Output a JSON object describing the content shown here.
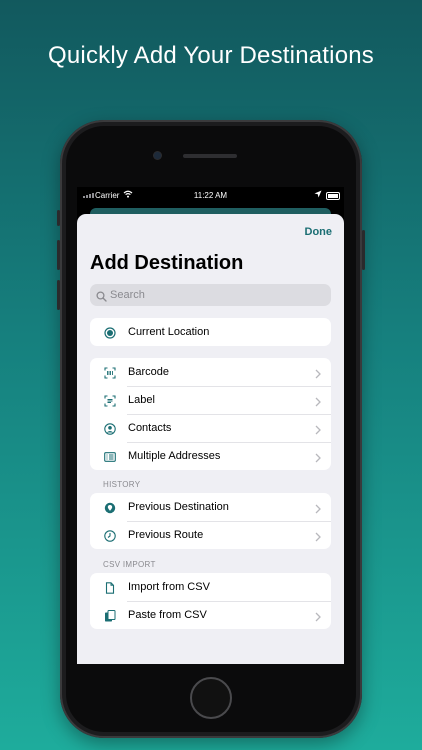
{
  "headline": "Quickly Add Your Destinations",
  "status_bar": {
    "carrier": "Carrier",
    "time": "11:22 AM"
  },
  "nav": {
    "done_label": "Done"
  },
  "page_title": "Add Destination",
  "search": {
    "placeholder": "Search"
  },
  "groups": {
    "location": {
      "items": [
        {
          "label": "Current Location",
          "icon": "location-target-icon"
        }
      ]
    },
    "scan": {
      "items": [
        {
          "label": "Barcode",
          "icon": "barcode-scan-icon"
        },
        {
          "label": "Label",
          "icon": "text-scan-icon"
        },
        {
          "label": "Contacts",
          "icon": "person-circle-icon"
        },
        {
          "label": "Multiple Addresses",
          "icon": "list-card-icon"
        }
      ]
    },
    "history": {
      "header": "HISTORY",
      "items": [
        {
          "label": "Previous Destination",
          "icon": "map-pin-icon"
        },
        {
          "label": "Previous Route",
          "icon": "clock-icon"
        }
      ]
    },
    "csv": {
      "header": "CSV IMPORT",
      "items": [
        {
          "label": "Import from CSV",
          "icon": "document-icon"
        },
        {
          "label": "Paste from CSV",
          "icon": "clipboard-copy-icon"
        }
      ]
    }
  },
  "colors": {
    "accent": "#1b6e73",
    "background_top": "#12595e",
    "background_bottom": "#1eac9c",
    "sheet": "#efeff4"
  }
}
